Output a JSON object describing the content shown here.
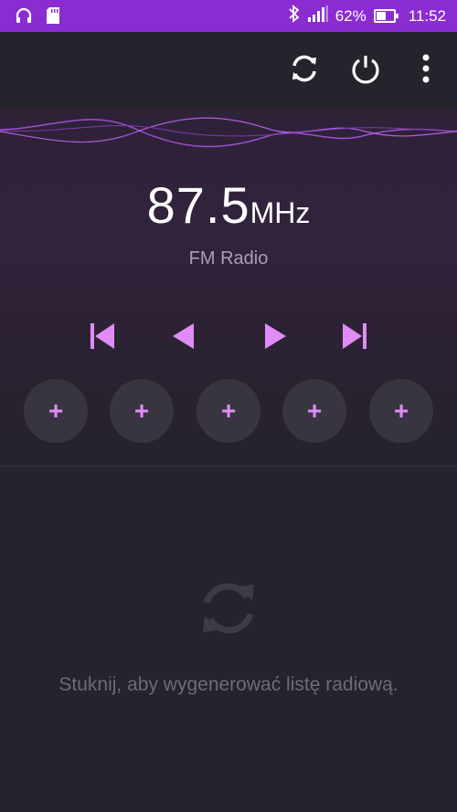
{
  "status_bar": {
    "battery_percent": "62%",
    "battery_level": 0.62,
    "time": "11:52",
    "icons": [
      "headset-icon",
      "sd-card-icon",
      "bluetooth-icon",
      "signal-icon",
      "battery-icon"
    ]
  },
  "toolbar": {
    "icons": [
      "refresh-icon",
      "power-icon",
      "more-vert-icon"
    ]
  },
  "tuner": {
    "frequency": "87.5",
    "unit": "MHz",
    "station_name": "FM Radio"
  },
  "controls": {
    "icons": [
      "skip-previous-icon",
      "step-back-icon",
      "step-forward-icon",
      "skip-next-icon"
    ]
  },
  "presets": [
    "+",
    "+",
    "+",
    "+",
    "+"
  ],
  "station_list": {
    "hint": "Stuknij, aby wygenerować listę radiową.",
    "icon": "refresh-icon"
  },
  "colors": {
    "status_bar": "#8a2cd0",
    "background": "#25232b",
    "accent": "#e08cf7",
    "preset_bg": "#383541"
  }
}
